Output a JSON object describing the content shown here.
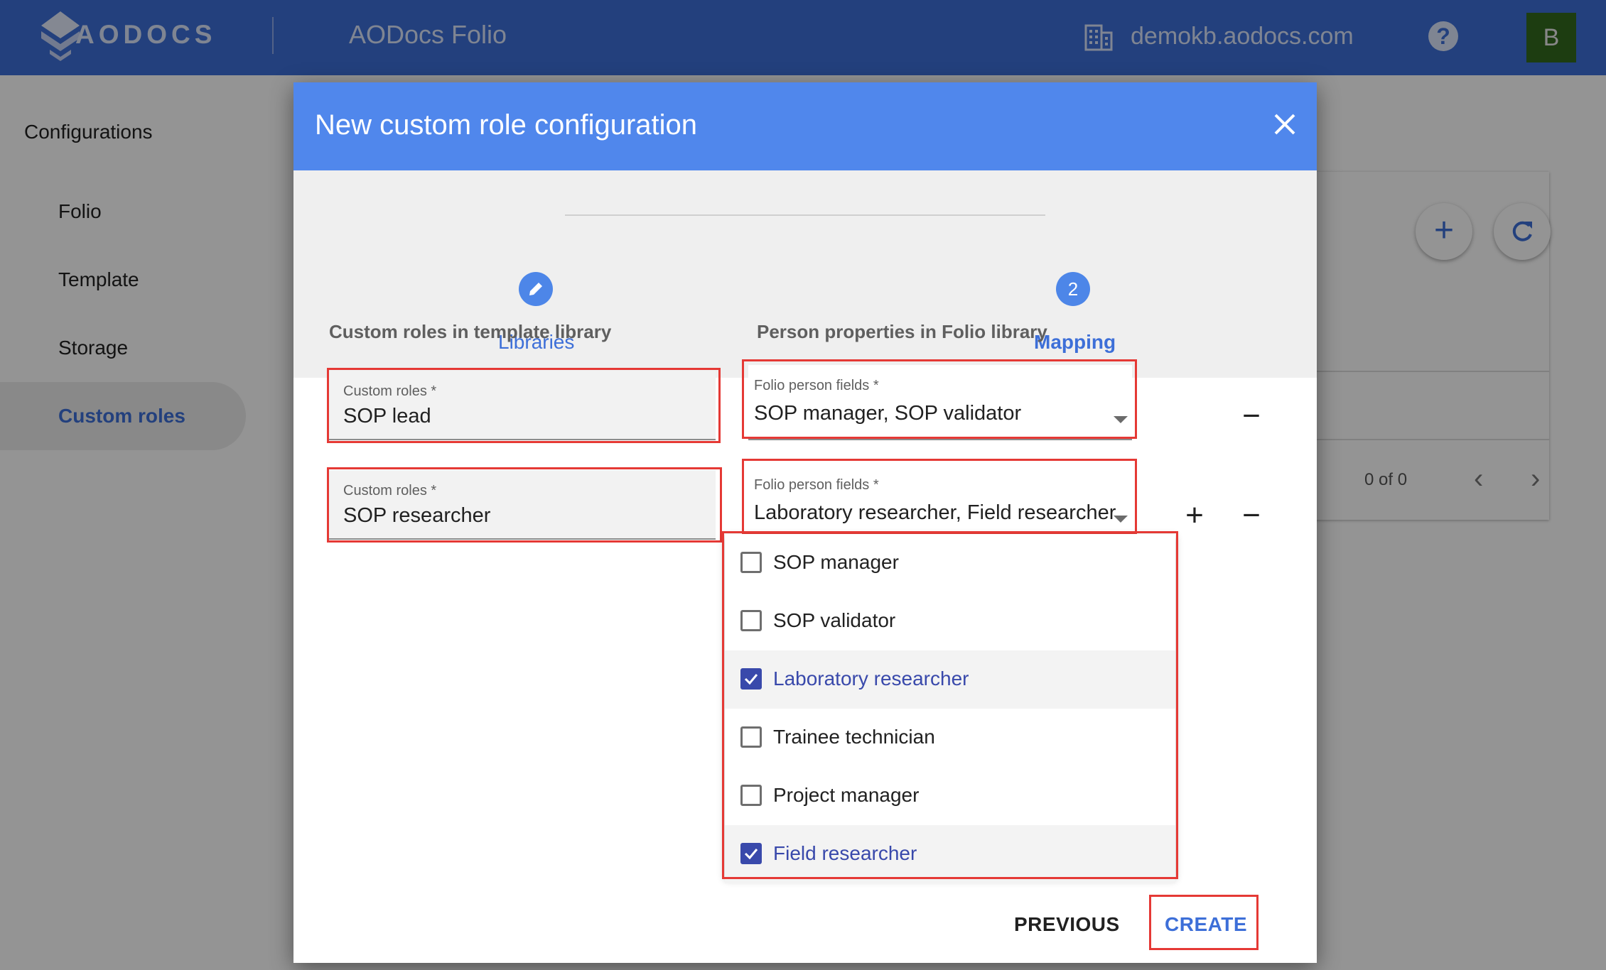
{
  "header": {
    "logo_text": "AODOCS",
    "app_title": "AODocs Folio",
    "domain": "demokb.aodocs.com",
    "avatar_letter": "B",
    "help_icon": "help-circle-icon",
    "domain_icon": "building-icon"
  },
  "sidebar": {
    "heading": "Configurations",
    "items": [
      {
        "label": "Folio"
      },
      {
        "label": "Template"
      },
      {
        "label": "Storage"
      },
      {
        "label": "Custom roles",
        "active": true
      }
    ]
  },
  "background": {
    "pager_text": "0 of 0",
    "add_icon": "plus-icon",
    "refresh_icon": "refresh-icon"
  },
  "dialog": {
    "title": "New custom role configuration",
    "close_icon": "close-icon",
    "steps": [
      {
        "label": "Libraries",
        "icon": "pencil-icon",
        "state": "done"
      },
      {
        "label": "Mapping",
        "number": "2",
        "state": "active"
      }
    ],
    "columns": {
      "left": "Custom roles in template library",
      "right": "Person properties in Folio library"
    },
    "rows": [
      {
        "role_label": "Custom roles *",
        "role_value": "SOP lead",
        "fields_label": "Folio person fields *",
        "fields_value": "SOP manager, SOP validator"
      },
      {
        "role_label": "Custom roles *",
        "role_value": "SOP researcher",
        "fields_label": "Folio person fields *",
        "fields_value": "Laboratory researcher, Field researcher"
      }
    ],
    "options": [
      {
        "label": "SOP manager",
        "checked": false
      },
      {
        "label": "SOP validator",
        "checked": false
      },
      {
        "label": "Laboratory researcher",
        "checked": true
      },
      {
        "label": "Trainee technician",
        "checked": false
      },
      {
        "label": "Project manager",
        "checked": false
      },
      {
        "label": "Field researcher",
        "checked": true
      }
    ],
    "buttons": {
      "previous": "PREVIOUS",
      "create": "CREATE"
    }
  },
  "colors": {
    "header_bg": "#3d6fd8",
    "dialog_header_bg": "#5087ec",
    "accent": "#3949ab",
    "highlight_border": "#e53935",
    "avatar_bg": "#33691e"
  }
}
